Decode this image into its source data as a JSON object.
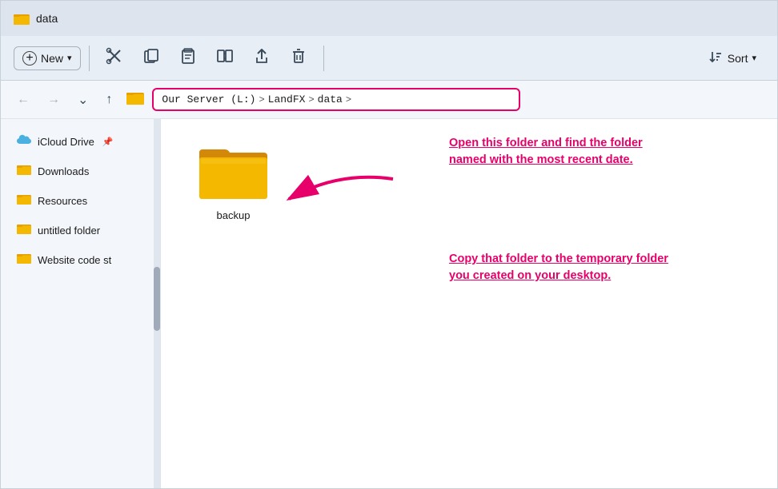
{
  "titleBar": {
    "title": "data",
    "folderIcon": "📁"
  },
  "toolbar": {
    "newLabel": "New",
    "newDropdown": "▾",
    "cutIcon": "✂",
    "copyIcon": "⧉",
    "pasteIcon": "📋",
    "renameIcon": "⊞",
    "shareIcon": "⬆",
    "deleteIcon": "🗑",
    "sortLabel": "Sort",
    "sortDropdown": "▾",
    "sortIcon": "↑↓"
  },
  "addressBar": {
    "breadcrumbs": [
      "Our Server (L:)",
      "LandFX",
      "data"
    ],
    "separators": [
      ">",
      ">",
      ">"
    ]
  },
  "nav": {
    "back": "←",
    "forward": "→",
    "dropdown": "⌄",
    "up": "↑"
  },
  "sidebar": {
    "items": [
      {
        "id": "icloud-drive",
        "label": "iCloud Drive",
        "icon": "cloud",
        "pinned": true
      },
      {
        "id": "downloads",
        "label": "Downloads",
        "icon": "folder"
      },
      {
        "id": "resources",
        "label": "Resources",
        "icon": "folder"
      },
      {
        "id": "untitled-folder",
        "label": "untitled folder",
        "icon": "folder"
      },
      {
        "id": "website-code",
        "label": "Website code st",
        "icon": "folder"
      }
    ]
  },
  "fileArea": {
    "items": [
      {
        "id": "backup",
        "label": "backup",
        "type": "folder"
      }
    ]
  },
  "annotations": {
    "text1": "Open this folder and  find the folder named with the most recent date.",
    "text2": "Copy that folder to the temporary folder you created on your desktop."
  }
}
